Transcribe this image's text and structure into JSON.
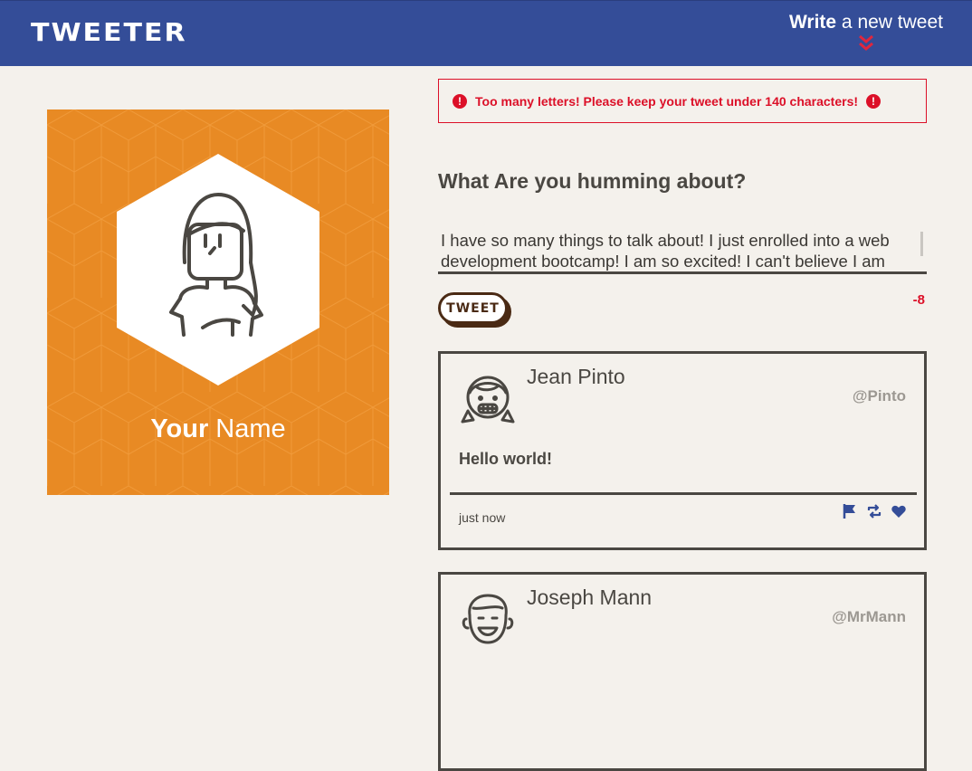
{
  "nav": {
    "brand": "TWEETER",
    "compose_bold": "Write",
    "compose_rest": " a new tweet"
  },
  "profile": {
    "first": "Your",
    "last": " Name"
  },
  "error": {
    "message": "Too many letters! Please keep your tweet under 140 characters!"
  },
  "compose": {
    "prompt": "What Are you humming about?",
    "text": "I have so many things to talk about! I just enrolled into a web development bootcamp! I am so excited! I can't believe I am",
    "button": "TWEET",
    "counter": "-8"
  },
  "tweets": [
    {
      "name": "Jean Pinto",
      "handle": "@Pinto",
      "content": "Hello world!",
      "time": "just now"
    },
    {
      "name": "Joseph Mann",
      "handle": "@MrMann",
      "content": "",
      "time": ""
    }
  ],
  "colors": {
    "nav": "#344d98",
    "background": "#f4f1ec",
    "profile": "#e88a24",
    "error": "#dc1028",
    "text": "#4a4742"
  }
}
